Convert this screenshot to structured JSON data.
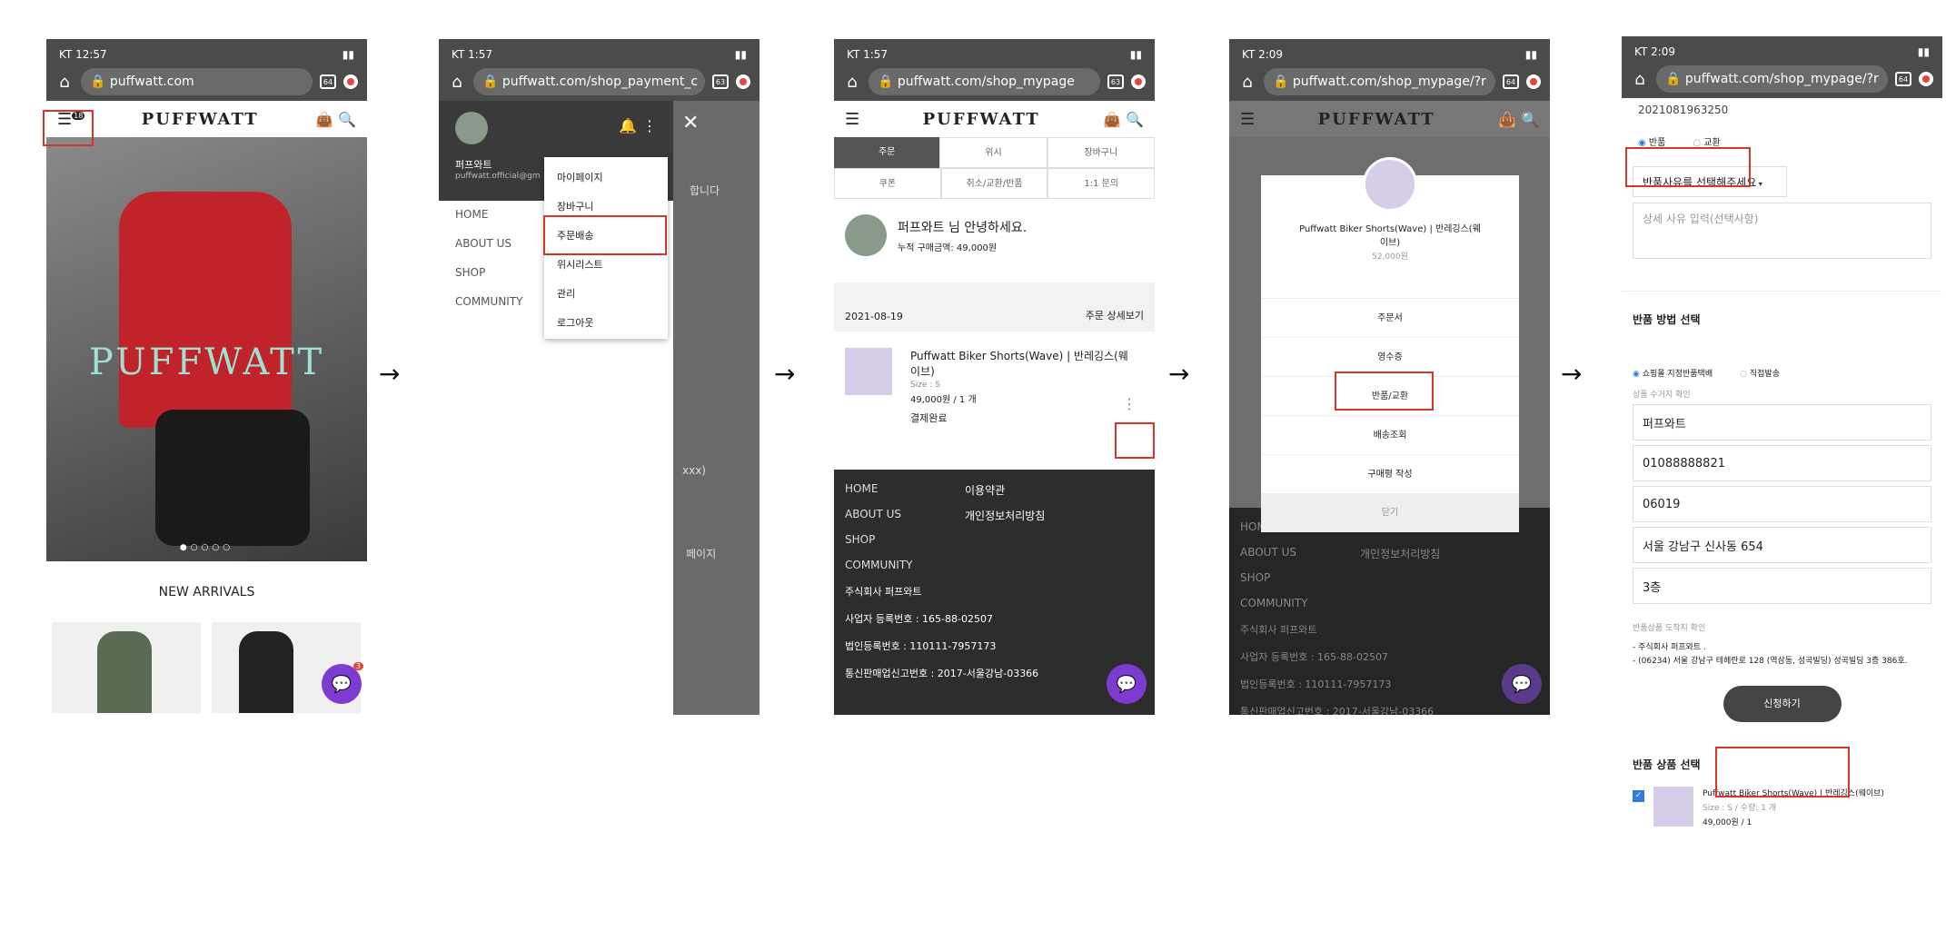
{
  "arrow": "→",
  "p1": {
    "status": "KT 12:57",
    "url": "puffwatt.com",
    "tabs": "64",
    "menu_badge": "18",
    "logo": "PUFFWATT",
    "banner_text": "PUFFWATT",
    "dots": "●○○○○",
    "new_arrivals": "NEW ARRIVALS",
    "chat_badge": "3"
  },
  "p2": {
    "status": "KT 1:57",
    "url": "puffwatt.com/shop_payment_c",
    "tabs": "63",
    "user_name": "퍼프와트",
    "user_email": "puffwatt.official@gm",
    "nav": [
      "HOME",
      "ABOUT US",
      "SHOP",
      "COMMUNITY"
    ],
    "dropdown": [
      "마이페이지",
      "장바구니",
      "주문배송",
      "위시리스트",
      "관리",
      "로그아웃"
    ],
    "bg_text1": "합니다",
    "bg_text2": "xxx)",
    "bg_text3": "페이지"
  },
  "p3": {
    "status": "KT 1:57",
    "url": "puffwatt.com/shop_mypage",
    "tabs": "63",
    "logo": "PUFFWATT",
    "tabs_row1": [
      "주문",
      "위시",
      "장바구니"
    ],
    "tabs_row2": [
      "쿠폰",
      "취소/교환/반품",
      "1:1 문의"
    ],
    "greeting": "퍼프와트 님 안녕하세요.",
    "total": "누적 구매금액: 49,000원",
    "date": "2021-08-19",
    "detail": "주문 상세보기",
    "product": "Puffwatt Biker Shorts(Wave) | 반레깅스(웨이브)",
    "size": "Size : S",
    "price": "49,000원 / 1 개",
    "status_text": "결제완료",
    "footer": [
      "HOME",
      "ABOUT US",
      "SHOP",
      "COMMUNITY"
    ],
    "footer_right": [
      "이용약관",
      "개인정보처리방침"
    ],
    "company": "주식회사 퍼프와트",
    "biz_no": "사업자 등록번호 : 165-88-02507",
    "corp_no": "법인등록번호 : 110111-7957173",
    "sale_no": "통신판매업신고번호 : 2017-서울강남-03366"
  },
  "p4": {
    "status": "KT 2:09",
    "url": "puffwatt.com/shop_mypage/?r",
    "tabs": "64",
    "logo": "PUFFWATT",
    "product": "Puffwatt Biker Shorts(Wave) | 반레깅스(웨이브)",
    "price": "52,000원",
    "menu": [
      "주문서",
      "영수증",
      "반품/교환",
      "배송조회",
      "구매평 작성"
    ],
    "close": "닫기",
    "footer": [
      "HOME",
      "ABOUT US",
      "SHOP",
      "COMMUNITY"
    ],
    "footer_right": "개인정보처리방침",
    "company": "주식회사 퍼프와트",
    "biz_no": "사업자 등록번호 : 165-88-02507",
    "corp_no": "법인등록번호 : 110111-7957173",
    "sale_no": "통신판매업신고번호 : 2017-서울강남-03366"
  },
  "p5": {
    "status": "KT 2:09",
    "url": "puffwatt.com/shop_mypage/?r",
    "tabs": "64",
    "order_no": "2021081963250",
    "return": "반품",
    "exchange": "교환",
    "reason": "반품사유를 선택해주세요",
    "detail_ph": "상세 사유 입력(선택사항)",
    "method_title": "반품 방법 선택",
    "method1": "쇼핑몰 지정반품택배",
    "method2": "직접발송",
    "pickup_label": "상품 수거지 확인",
    "fields": [
      "퍼프와트",
      "01088888821",
      "06019",
      "서울 강남구 신사동 654",
      "3층"
    ],
    "dest_label": "반품상품 도착지 확인",
    "dest_company": "- 주식회사 퍼프와트 .",
    "dest_addr": "- (06234) 서울 강남구 테헤란로 128 (역삼동, 성곡빌딩) 성곡빌딩 3층 386호.",
    "submit": "신청하기",
    "select_title": "반품 상품 선택",
    "item_name": "Puffwatt Biker Shorts(Wave) | 반레깅스(웨이브)",
    "item_size": "Size : S / 수량: 1 개",
    "item_price": "49,000원 / 1"
  }
}
